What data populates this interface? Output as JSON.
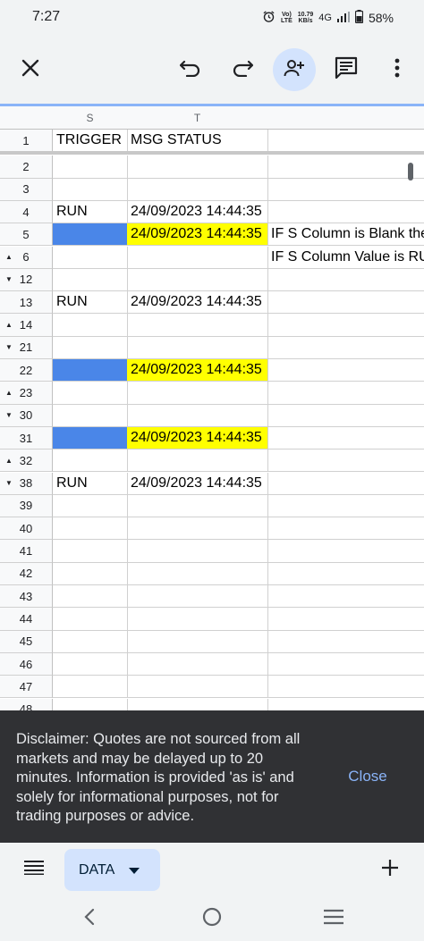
{
  "status_bar": {
    "time": "7:27",
    "volte_top": "Vo)",
    "volte_bottom": "LTE",
    "speed_value": "10.79",
    "speed_unit": "KB/s",
    "network": "4G",
    "battery": "58%"
  },
  "toolbar": {
    "close_icon": "close-icon",
    "undo_icon": "undo-icon",
    "redo_icon": "redo-icon",
    "share_icon": "person-add-icon",
    "comment_icon": "comment-icon",
    "more_icon": "more-vert-icon"
  },
  "sheet": {
    "columns": [
      "S",
      "T",
      ""
    ],
    "rows": [
      {
        "num": "1",
        "arrow": "",
        "s": "TRIGGER",
        "t": "MSG STATUS",
        "extra": ""
      },
      {
        "num": "2",
        "arrow": "",
        "s": "",
        "t": "",
        "extra": ""
      },
      {
        "num": "3",
        "arrow": "",
        "s": "",
        "t": "",
        "extra": ""
      },
      {
        "num": "4",
        "arrow": "",
        "s": "RUN",
        "t": "24/09/2023 14:44:35",
        "extra": ""
      },
      {
        "num": "5",
        "arrow": "",
        "s": "",
        "t": "24/09/2023 14:44:35",
        "extra": "IF S Column is Blank the",
        "s_fill": "blue",
        "t_fill": "yellow"
      },
      {
        "num": "6",
        "arrow": "▲",
        "s": "",
        "t": "",
        "extra": "IF S Column Value is RU"
      },
      {
        "num": "12",
        "arrow": "▼",
        "s": "",
        "t": "",
        "extra": ""
      },
      {
        "num": "13",
        "arrow": "",
        "s": "RUN",
        "t": "24/09/2023 14:44:35",
        "extra": ""
      },
      {
        "num": "14",
        "arrow": "▲",
        "s": "",
        "t": "",
        "extra": ""
      },
      {
        "num": "21",
        "arrow": "▼",
        "s": "",
        "t": "",
        "extra": ""
      },
      {
        "num": "22",
        "arrow": "",
        "s": "",
        "t": "24/09/2023 14:44:35",
        "extra": "",
        "s_fill": "blue",
        "t_fill": "yellow"
      },
      {
        "num": "23",
        "arrow": "▲",
        "s": "",
        "t": "",
        "extra": ""
      },
      {
        "num": "30",
        "arrow": "▼",
        "s": "",
        "t": "",
        "extra": ""
      },
      {
        "num": "31",
        "arrow": "",
        "s": "",
        "t": "24/09/2023 14:44:35",
        "extra": "",
        "s_fill": "blue",
        "t_fill": "yellow"
      },
      {
        "num": "32",
        "arrow": "▲",
        "s": "",
        "t": "",
        "extra": ""
      },
      {
        "num": "38",
        "arrow": "▼",
        "s": "RUN",
        "t": "24/09/2023 14:44:35",
        "extra": ""
      },
      {
        "num": "39",
        "arrow": "",
        "s": "",
        "t": "",
        "extra": ""
      },
      {
        "num": "40",
        "arrow": "",
        "s": "",
        "t": "",
        "extra": ""
      },
      {
        "num": "41",
        "arrow": "",
        "s": "",
        "t": "",
        "extra": ""
      },
      {
        "num": "42",
        "arrow": "",
        "s": "",
        "t": "",
        "extra": ""
      },
      {
        "num": "43",
        "arrow": "",
        "s": "",
        "t": "",
        "extra": ""
      },
      {
        "num": "44",
        "arrow": "",
        "s": "",
        "t": "",
        "extra": ""
      },
      {
        "num": "45",
        "arrow": "",
        "s": "",
        "t": "",
        "extra": ""
      },
      {
        "num": "46",
        "arrow": "",
        "s": "",
        "t": "",
        "extra": ""
      },
      {
        "num": "47",
        "arrow": "",
        "s": "",
        "t": "",
        "extra": ""
      },
      {
        "num": "48",
        "arrow": "",
        "s": "",
        "t": "",
        "extra": ""
      }
    ],
    "colors": {
      "highlight_yellow": "#ffff00",
      "highlight_blue": "#4a86e8"
    }
  },
  "disclaimer": {
    "text": "Disclaimer: Quotes are not sourced from all markets and may be delayed up to 20 minutes. Information is provided 'as is' and solely for informational purposes, not for trading purposes or advice.",
    "close_label": "Close"
  },
  "tabs": {
    "active_tab": "DATA",
    "menu_icon": "list-icon",
    "dropdown_icon": "dropdown-arrow-icon",
    "add_icon": "plus-icon"
  },
  "nav": {
    "back_icon": "back-icon",
    "home_icon": "home-icon",
    "recents_icon": "recents-icon"
  }
}
